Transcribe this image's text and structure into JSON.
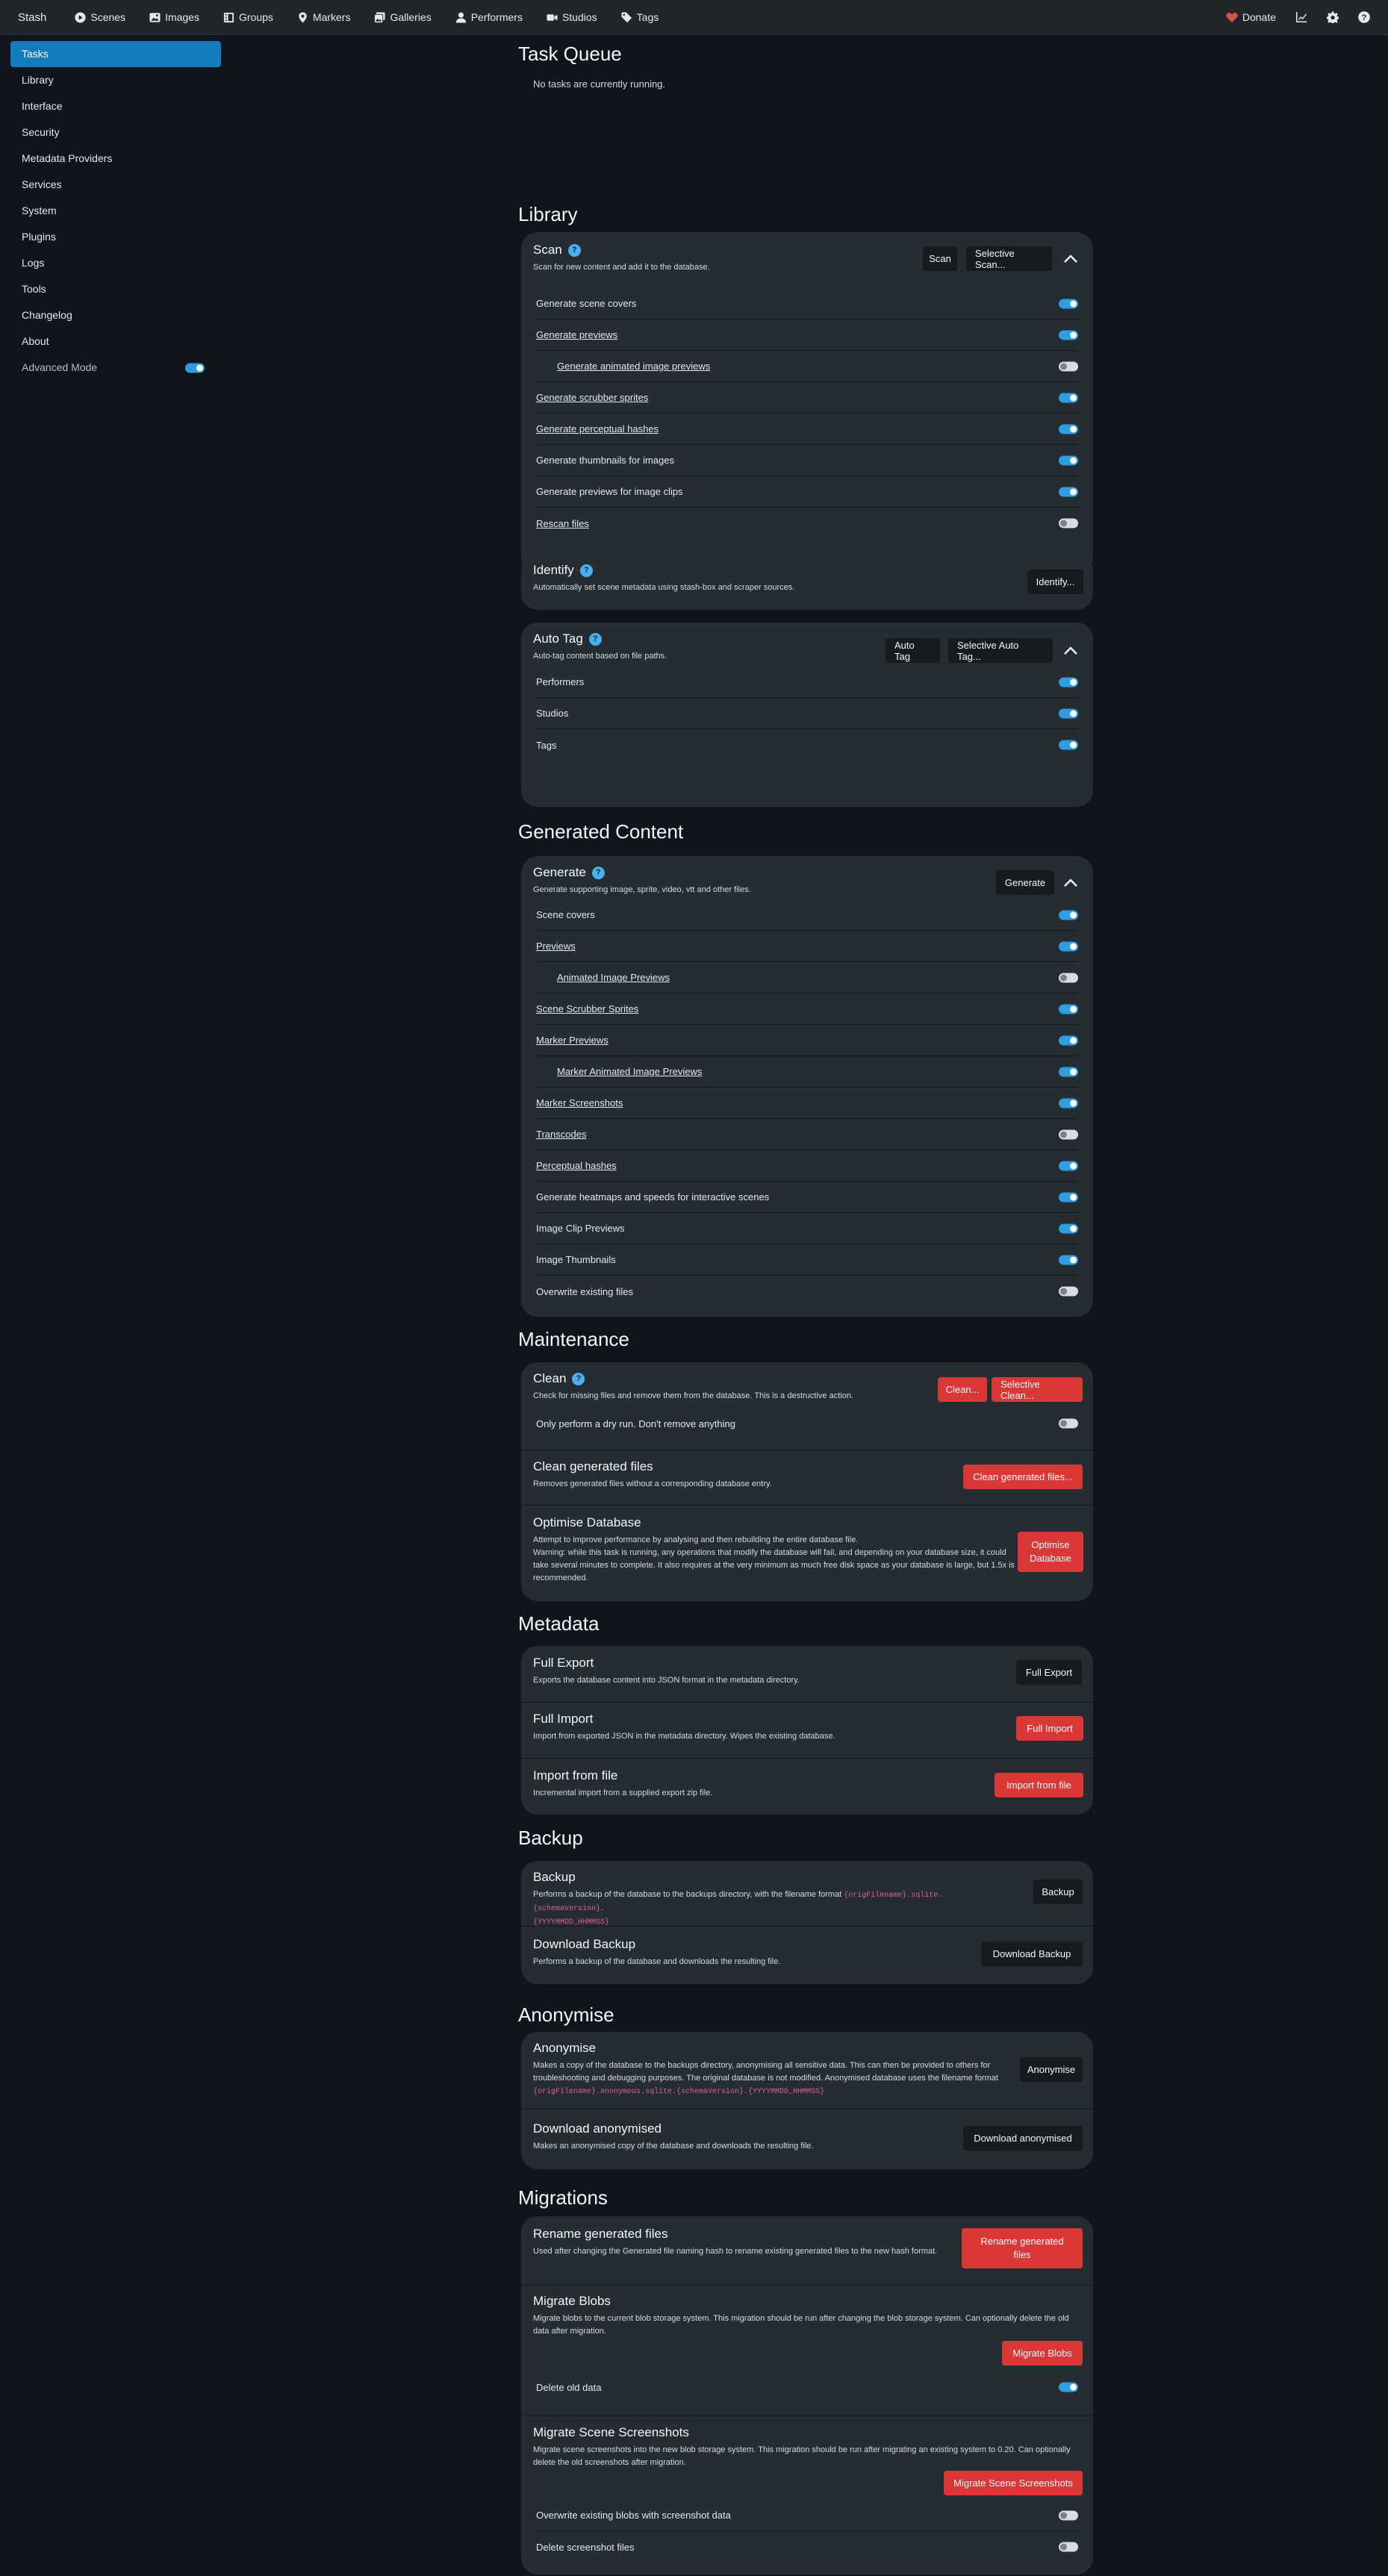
{
  "navbar": {
    "brand": "Stash",
    "items": [
      {
        "label": "Scenes",
        "icon": "play-circle-icon"
      },
      {
        "label": "Images",
        "icon": "image-icon"
      },
      {
        "label": "Groups",
        "icon": "film-icon"
      },
      {
        "label": "Markers",
        "icon": "map-marker-icon"
      },
      {
        "label": "Galleries",
        "icon": "images-icon"
      },
      {
        "label": "Performers",
        "icon": "user-icon"
      },
      {
        "label": "Studios",
        "icon": "video-icon"
      },
      {
        "label": "Tags",
        "icon": "tag-icon"
      }
    ],
    "donate": "Donate"
  },
  "sidebar": {
    "items": [
      "Tasks",
      "Library",
      "Interface",
      "Security",
      "Metadata Providers",
      "Services",
      "System",
      "Plugins",
      "Logs",
      "Tools",
      "Changelog",
      "About"
    ],
    "active": "Tasks",
    "advanced_mode": "Advanced Mode",
    "advanced_mode_on": true
  },
  "task_queue": {
    "title": "Task Queue",
    "empty": "No tasks are currently running."
  },
  "library": {
    "title": "Library",
    "scan": {
      "title": "Scan",
      "desc": "Scan for new content and add it to the database.",
      "btn_scan": "Scan",
      "btn_selective": "Selective Scan...",
      "options": [
        {
          "label": "Generate scene covers",
          "on": true
        },
        {
          "label": "Generate previews",
          "on": true
        },
        {
          "label": "Generate animated image previews",
          "on": false
        },
        {
          "label": "Generate scrubber sprites",
          "on": true
        },
        {
          "label": "Generate perceptual hashes",
          "on": true
        },
        {
          "label": "Generate thumbnails for images",
          "on": true
        },
        {
          "label": "Generate previews for image clips",
          "on": true
        },
        {
          "label": "Rescan files",
          "on": false
        }
      ]
    },
    "identify": {
      "title": "Identify",
      "desc": "Automatically set scene metadata using stash-box and scraper sources.",
      "btn": "Identify..."
    },
    "autotag": {
      "title": "Auto Tag",
      "desc": "Auto-tag content based on file paths.",
      "btn_autotag": "Auto Tag",
      "btn_selective": "Selective Auto Tag...",
      "options": [
        {
          "label": "Performers",
          "on": true
        },
        {
          "label": "Studios",
          "on": true
        },
        {
          "label": "Tags",
          "on": true
        }
      ]
    }
  },
  "generated": {
    "title": "Generated Content",
    "generate": {
      "title": "Generate",
      "desc": "Generate supporting image, sprite, video, vtt and other files.",
      "btn": "Generate",
      "options": [
        {
          "label": "Scene covers",
          "on": true
        },
        {
          "label": "Previews",
          "on": true
        },
        {
          "label": "Animated Image Previews",
          "on": false
        },
        {
          "label": "Scene Scrubber Sprites",
          "on": true
        },
        {
          "label": "Marker Previews",
          "on": true
        },
        {
          "label": "Marker Animated Image Previews",
          "on": true
        },
        {
          "label": "Marker Screenshots",
          "on": true
        },
        {
          "label": "Transcodes",
          "on": false
        },
        {
          "label": "Perceptual hashes",
          "on": true
        },
        {
          "label": "Generate heatmaps and speeds for interactive scenes",
          "on": true
        },
        {
          "label": "Image Clip Previews",
          "on": true
        },
        {
          "label": "Image Thumbnails",
          "on": true
        },
        {
          "label": "Overwrite existing files",
          "on": false
        }
      ]
    }
  },
  "maintenance": {
    "title": "Maintenance",
    "clean": {
      "title": "Clean",
      "desc": "Check for missing files and remove them from the database. This is a destructive action.",
      "btn_clean": "Clean...",
      "btn_selective": "Selective Clean...",
      "dry_run": "Only perform a dry run. Don't remove anything",
      "dry_run_on": false
    },
    "clean_generated": {
      "title": "Clean generated files",
      "desc": "Removes generated files without a corresponding database entry.",
      "btn": "Clean generated files..."
    },
    "optimise": {
      "title": "Optimise Database",
      "desc1": "Attempt to improve performance by analysing and then rebuilding the entire database file.",
      "desc2": "Warning: while this task is running, any operations that modify the database will fail, and depending on your database size, it could take several minutes to complete. It also requires at the very minimum as much free disk space as your database is large, but 1.5x is recommended.",
      "btn": "Optimise Database"
    }
  },
  "metadata": {
    "title": "Metadata",
    "full_export": {
      "title": "Full Export",
      "desc": "Exports the database content into JSON format in the metadata directory.",
      "btn": "Full Export"
    },
    "full_import": {
      "title": "Full Import",
      "desc": "Import from exported JSON in the metadata directory. Wipes the existing database.",
      "btn": "Full Import"
    },
    "import_file": {
      "title": "Import from file",
      "desc": "Incremental import from a supplied export zip file.",
      "btn": "Import from file"
    }
  },
  "backup": {
    "title": "Backup",
    "backup": {
      "title": "Backup",
      "desc": "Performs a backup of the database to the backups directory, with the filename format",
      "code1": "{origFilename}.sqlite.{schemaVersion}.",
      "code2": "{YYYYMMDD_HHMMSS}",
      "btn": "Backup"
    },
    "download": {
      "title": "Download Backup",
      "desc": "Performs a backup of the database and downloads the resulting file.",
      "btn": "Download Backup"
    }
  },
  "anonymise": {
    "title": "Anonymise",
    "anonymise": {
      "title": "Anonymise",
      "desc": "Makes a copy of the database to the backups directory, anonymising all sensitive data. This can then be provided to others for troubleshooting and debugging purposes. The original database is not modified. Anonymised database uses the filename format",
      "code": "{origFilename}.anonymous.sqlite.{schemaVersion}.{YYYYMMDD_HHMMSS}",
      "btn": "Anonymise"
    },
    "download": {
      "title": "Download anonymised",
      "desc": "Makes an anonymised copy of the database and downloads the resulting file.",
      "btn": "Download anonymised"
    }
  },
  "migrations": {
    "title": "Migrations",
    "rename": {
      "title": "Rename generated files",
      "desc": "Used after changing the Generated file naming hash to rename existing generated files to the new hash format.",
      "btn": "Rename generated files"
    },
    "blobs": {
      "title": "Migrate Blobs",
      "desc": "Migrate blobs to the current blob storage system. This migration should be run after changing the blob storage system. Can optionally delete the old data after migration.",
      "btn": "Migrate Blobs",
      "option": "Delete old data",
      "option_on": true
    },
    "screenshots": {
      "title": "Migrate Scene Screenshots",
      "desc": "Migrate scene screenshots into the new blob storage system. This migration should be run after migrating an existing system to 0.20. Can optionally delete the old screenshots after migration.",
      "btn": "Migrate Scene Screenshots",
      "options": [
        {
          "label": "Overwrite existing blobs with screenshot data",
          "on": false
        },
        {
          "label": "Delete screenshot files",
          "on": false
        }
      ]
    }
  }
}
